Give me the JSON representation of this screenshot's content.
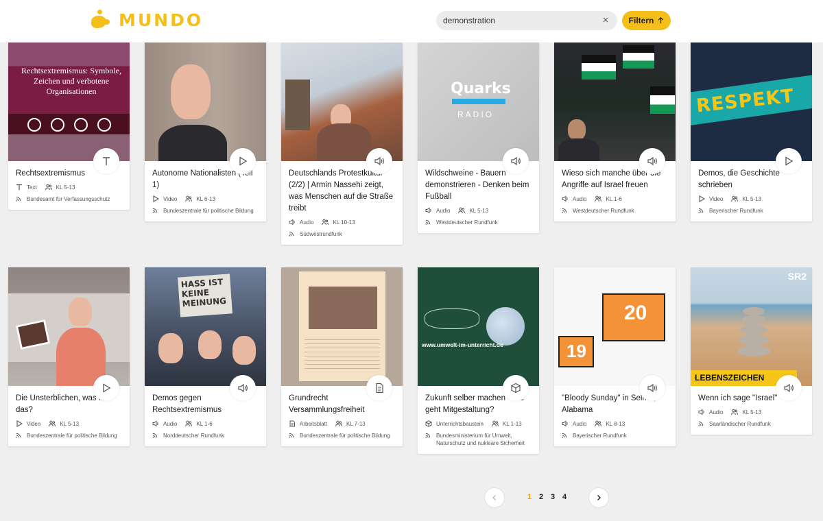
{
  "header": {
    "logo_text": "MUNDO",
    "search_value": "demonstration",
    "filter_label": "Filtern"
  },
  "row1": [
    {
      "title": "Rechtsextremismus",
      "type": "Text",
      "grade": "KL 5-13",
      "source": "Bundesamt für Verfassungsschutz",
      "type_icon": "text-icon",
      "thumb_text": "Rechtsextremismus: Symbole, Zeichen und verbotene Organisationen"
    },
    {
      "title": "Autonome Nationalisten (Teil 1)",
      "type": "Video",
      "grade": "KL 6-13",
      "source": "Bundeszentrale für politische Bildung",
      "type_icon": "play-icon"
    },
    {
      "title": "Deutschlands Protestkultur (2/2) | Armin Nassehi zeigt, was Menschen auf die Straße treibt",
      "type": "Audio",
      "grade": "KL 10-13",
      "source": "Südwestrundfunk",
      "type_icon": "speaker-icon"
    },
    {
      "title": "Wildschweine - Bauern demonstrieren - Denken beim Fußball",
      "type": "Audio",
      "grade": "KL 5-13",
      "source": "Westdeutscher Rundfunk",
      "type_icon": "speaker-icon",
      "thumb_text": "Quarks",
      "thumb_sub": "RADIO"
    },
    {
      "title": "Wieso sich manche über die Angriffe auf Israel freuen",
      "type": "Audio",
      "grade": "KL 1-6",
      "source": "Westdeutscher Rundfunk",
      "type_icon": "speaker-icon"
    },
    {
      "title": "Demos, die Geschichte schrieben",
      "type": "Video",
      "grade": "KL 5-13",
      "source": "Bayerischer Rundfunk",
      "type_icon": "play-icon",
      "thumb_text": "RESPEKT"
    }
  ],
  "row2": [
    {
      "title": "Die Unsterblichen, was ist das?",
      "type": "Video",
      "grade": "KL 5-13",
      "source": "Bundeszentrale für politische Bildung",
      "type_icon": "play-icon"
    },
    {
      "title": "Demos gegen Rechtsextremismus",
      "type": "Audio",
      "grade": "KL 1-6",
      "source": "Norddeutscher Rundfunk",
      "type_icon": "speaker-icon",
      "thumb_text": "HASS IST KEINE MEINUNG"
    },
    {
      "title": "Grundrecht Versammlungsfreiheit",
      "type": "Arbeitsblatt",
      "grade": "KL 7-13",
      "source": "Bundeszentrale für politische Bildung",
      "type_icon": "document-icon"
    },
    {
      "title": "Zukunft selber machen - wie geht Mitgestaltung?",
      "type": "Unterrichtsbaustein",
      "grade": "KL 1-13",
      "source": "Bundesministerium für Umwelt, Naturschutz und nukleare Sicherheit",
      "type_icon": "cube-icon",
      "thumb_text": "www.umwelt-im-unterricht.de"
    },
    {
      "title": "\"Bloody Sunday\" in Selma, Alabama",
      "type": "Audio",
      "grade": "KL 8-13",
      "source": "Bayerischer Rundfunk",
      "type_icon": "speaker-icon",
      "thumb_big": "20",
      "thumb_small": "19"
    },
    {
      "title": "Wenn ich sage \"Israel\"",
      "type": "Audio",
      "grade": "KL 5-13",
      "source": "Saarländischer Rundfunk",
      "type_icon": "speaker-icon",
      "thumb_text": "LEBENSZEICHEN",
      "thumb_sub": "SR2"
    }
  ],
  "pagination": {
    "pages": [
      "1",
      "2",
      "3",
      "4"
    ],
    "active": "1"
  },
  "colors": {
    "accent": "#f5bf1a",
    "background": "#efefef"
  }
}
